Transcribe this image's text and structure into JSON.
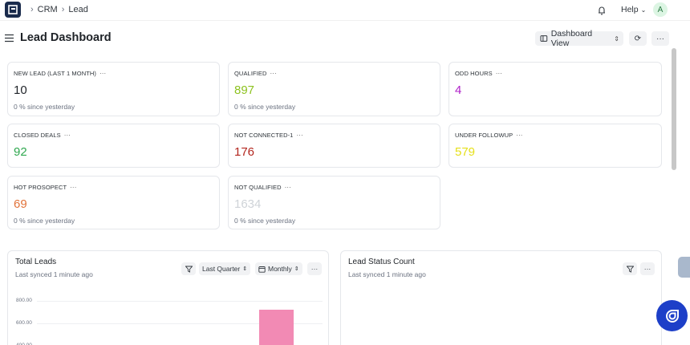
{
  "breadcrumb": {
    "root": "CRM",
    "current": "Lead"
  },
  "header": {
    "help_label": "Help",
    "avatar_initial": "A"
  },
  "page": {
    "title": "Lead Dashboard",
    "view_label": "Dashboard View"
  },
  "metrics": [
    {
      "label": "NEW LEAD (LAST 1 MONTH)",
      "value": "10",
      "sub": "0 % since yesterday",
      "color": "#1f2328"
    },
    {
      "label": "QUALIFIED",
      "value": "897",
      "sub": "0 % since yesterday",
      "color": "#8dc21f"
    },
    {
      "label": "ODD HOURS",
      "value": "4",
      "sub": "",
      "color": "#b022c9"
    },
    {
      "label": "CLOSED DEALS",
      "value": "92",
      "sub": "",
      "color": "#2fa84f"
    },
    {
      "label": "NOT CONNECTED-1",
      "value": "176",
      "sub": "",
      "color": "#b3261e"
    },
    {
      "label": "UNDER FOLLOWUP",
      "value": "579",
      "sub": "",
      "color": "#e6e01a"
    },
    {
      "label": "HOT PROSOPECT",
      "value": "69",
      "sub": "0 % since yesterday",
      "color": "#e2733a"
    },
    {
      "label": "NOT QUALIFIED",
      "value": "1634",
      "sub": "0 % since yesterday",
      "color": "#cfd3d8"
    }
  ],
  "total_leads": {
    "title": "Total Leads",
    "synced": "Last synced 1 minute ago",
    "period": "Last Quarter",
    "interval": "Monthly"
  },
  "lead_status": {
    "title": "Lead Status Count",
    "synced": "Last synced 1 minute ago"
  },
  "chart_data": {
    "type": "bar",
    "title": "Total Leads",
    "y_ticks": [
      "800.00",
      "600.00",
      "400.00"
    ],
    "ylim": [
      400,
      800
    ],
    "values": [
      720
    ],
    "bar_color": "#f28ab4"
  },
  "colors": {
    "fab": "#1d3fc8",
    "logo": "#1a2b4c"
  }
}
